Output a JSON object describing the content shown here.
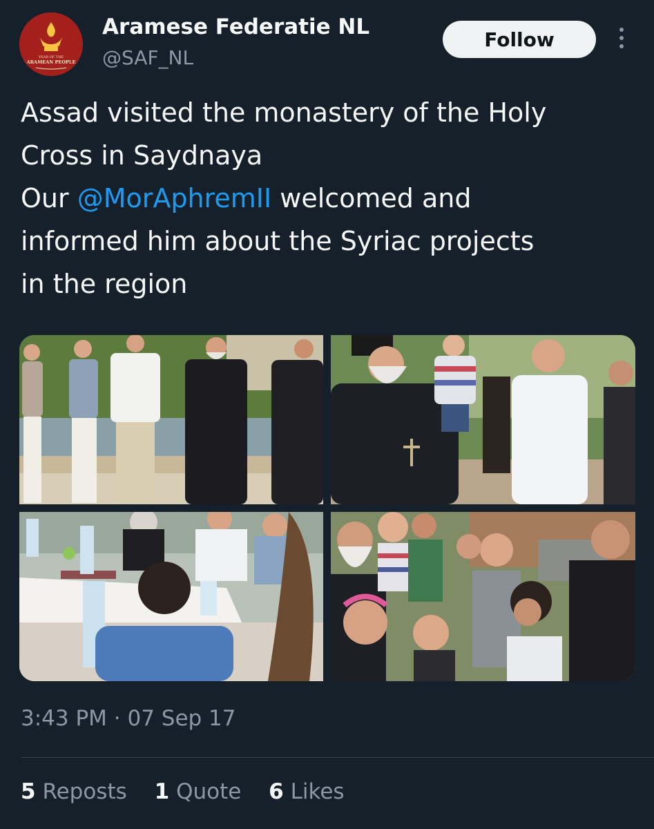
{
  "author": {
    "display_name": "Aramese Federatie NL",
    "handle": "@SAF_NL",
    "avatar_text": [
      "YEAR OF THE",
      "ARAMEAN PEOPLE"
    ]
  },
  "follow_label": "Follow",
  "tweet": {
    "line1": "Assad visited the monastery of the Holy",
    "line2": "Cross in Saydnaya",
    "line3_prefix": "Our ",
    "line3_mention": "@MorAphremII",
    "line3_suffix": " welcomed and",
    "line4": "informed him about the Syriac projects",
    "line5": "in the region"
  },
  "timestamp": "3:43 PM · 07 Sep 17",
  "stats": [
    {
      "count": "5",
      "label": "Reposts"
    },
    {
      "count": "1",
      "label": "Quote"
    },
    {
      "count": "6",
      "label": "Likes"
    }
  ],
  "colors": {
    "background": "#15202b",
    "link": "#1d9bf0",
    "secondary_text": "#8b98a5",
    "avatar_bg": "#a3201c"
  },
  "icons": [
    "more-vertical-icon"
  ]
}
